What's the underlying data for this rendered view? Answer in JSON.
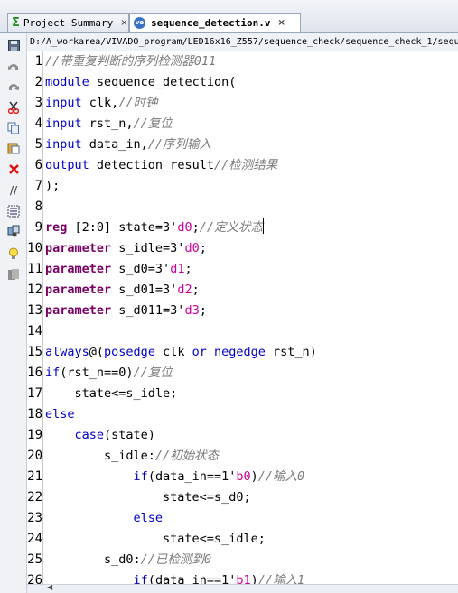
{
  "tabs": [
    {
      "label": "Project Summary",
      "close": "×",
      "icon": "sigma-icon"
    },
    {
      "label": "sequence_detection.v",
      "close": "×",
      "icon": "verilog-file-icon"
    }
  ],
  "path": "D:/A_workarea/VIVADO_program/LED16x16_Z557/sequence_check/sequence_check_1/sequ",
  "toolbar_icons": [
    "save-icon",
    "undo-icon",
    "redo-icon",
    "cut-icon",
    "copy-icon",
    "paste-icon",
    "delete-icon",
    "comment-icon",
    "indent-icon",
    "insert-template-icon",
    "lightbulb-icon",
    "bookmark-icon"
  ],
  "colors": {
    "keyword": "#0000cc",
    "keyword_bold": "#7a0063",
    "comment": "#7a7a7a",
    "number": "#cc0099"
  },
  "line_numbers": [
    "1",
    "2",
    "3",
    "4",
    "5",
    "6",
    "7",
    "8",
    "9",
    "10",
    "11",
    "12",
    "13",
    "14",
    "15",
    "16",
    "17",
    "18",
    "19",
    "20",
    "21",
    "22",
    "23",
    "24",
    "25",
    "26"
  ],
  "code": {
    "l1_cm": "//带重复判断的序列检测器011",
    "l2_kw": "module",
    "l2_t": " sequence_detection(",
    "l3_kw": "input",
    "l3_t": " clk,",
    "l3_cm": "//时钟",
    "l4_kw": "input",
    "l4_t": " rst_n,",
    "l4_cm": "//复位",
    "l5_kw": "input",
    "l5_t": " data_in,",
    "l5_cm": "//序列输入",
    "l6_kw": "output",
    "l6_t": " detection_result",
    "l6_cm": "//检测结果",
    "l7_t": ");",
    "l9_kw": "reg",
    "l9_t1": " [2:0] state=3'",
    "l9_num": "d0",
    "l9_t2": ";",
    "l9_cm": "//定义状态",
    "l10_kw": "parameter",
    "l10_t": " s_idle=3'",
    "l10_num": "d0",
    "l10_t2": ";",
    "l11_kw": "parameter",
    "l11_t": " s_d0=3'",
    "l11_num": "d1",
    "l11_t2": ";",
    "l12_kw": "parameter",
    "l12_t": " s_d01=3'",
    "l12_num": "d2",
    "l12_t2": ";",
    "l13_kw": "parameter",
    "l13_t": " s_d011=3'",
    "l13_num": "d3",
    "l13_t2": ";",
    "l15_kw1": "always",
    "l15_t1": "@(",
    "l15_kw2": "posedge",
    "l15_t2": " clk ",
    "l15_kw3": "or",
    "l15_t3": " ",
    "l15_kw4": "negedge",
    "l15_t4": " rst_n)",
    "l16_kw": "if",
    "l16_t": "(rst_n==0)",
    "l16_cm": "//复位",
    "l17_t": "    state<=s_idle;",
    "l18_kw": "else",
    "l19_ind": "    ",
    "l19_kw": "case",
    "l19_t": "(state)",
    "l20_t": "        s_idle:",
    "l20_cm": "//初始状态",
    "l21_ind": "            ",
    "l21_kw": "if",
    "l21_t1": "(data_in==1'",
    "l21_num": "b0",
    "l21_t2": ")",
    "l21_cm": "//输入0",
    "l22_t": "                state<=s_d0;",
    "l23_ind": "            ",
    "l23_kw": "else",
    "l24_t": "                state<=s_idle;",
    "l25_t": "        s_d0:",
    "l25_cm": "//已检测到0",
    "l26_ind": "            ",
    "l26_kw": "if",
    "l26_t1": "(data_in==1'",
    "l26_num": "b1",
    "l26_t2": ")",
    "l26_cm": "//输入1"
  }
}
